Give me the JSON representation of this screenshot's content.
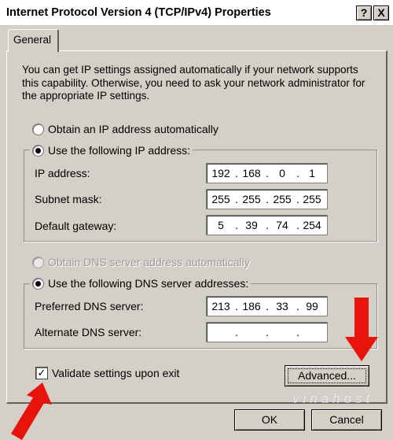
{
  "window": {
    "title": "Internet Protocol Version 4 (TCP/IPv4) Properties",
    "help_label": "?",
    "close_label": "X"
  },
  "tab": {
    "label": "General"
  },
  "description": "You can get IP settings assigned automatically if your network supports this capability. Otherwise, you need to ask your network administrator for the appropriate IP settings.",
  "ip": {
    "auto_label": "Obtain an IP address automatically",
    "manual_label": "Use the following IP address:",
    "selected": "manual",
    "fields": [
      {
        "label": "IP address:",
        "octets": [
          "192",
          "168",
          "0",
          "1"
        ]
      },
      {
        "label": "Subnet mask:",
        "octets": [
          "255",
          "255",
          "255",
          "255"
        ]
      },
      {
        "label": "Default gateway:",
        "octets": [
          "5",
          "39",
          "74",
          "254"
        ]
      }
    ]
  },
  "dns": {
    "auto_label": "Obtain DNS server address automatically",
    "manual_label": "Use the following DNS server addresses:",
    "selected": "manual",
    "fields": [
      {
        "label": "Preferred DNS server:",
        "octets": [
          "213",
          "186",
          "33",
          "99"
        ]
      },
      {
        "label": "Alternate DNS server:",
        "octets": [
          "",
          "",
          "",
          ""
        ]
      }
    ]
  },
  "validate": {
    "label": "Validate settings upon exit",
    "checked": true,
    "check_glyph": "✓"
  },
  "buttons": {
    "advanced": "Advanced...",
    "ok": "OK",
    "cancel": "Cancel"
  },
  "watermark": "vinahost",
  "colors": {
    "arrow": "#e8140c",
    "dialog_bg": "#d4d0c8"
  },
  "icons": {
    "arrow": "red-arrow-icon"
  }
}
